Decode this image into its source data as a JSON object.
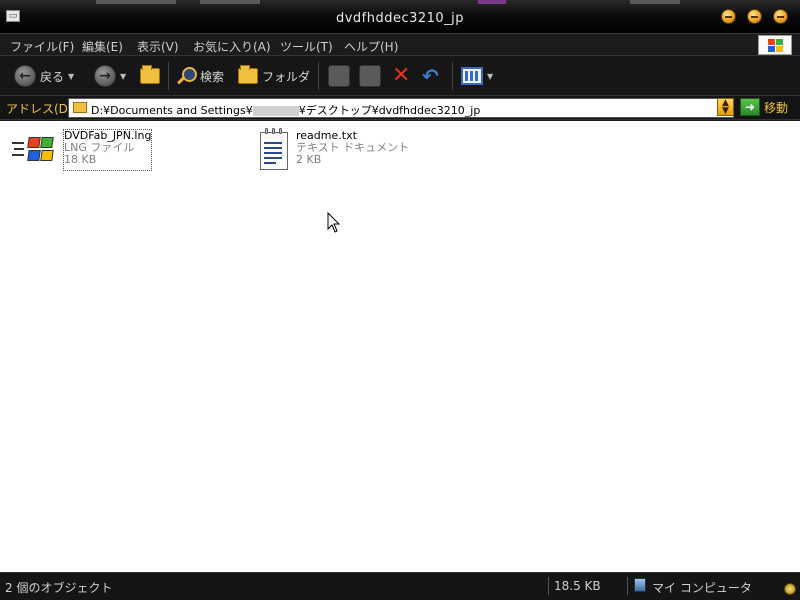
{
  "window": {
    "title": "dvdfhddec3210_jp",
    "accent": "#f0c040"
  },
  "menubar": {
    "items": [
      "ファイル(F)",
      "編集(E)",
      "表示(V)",
      "お気に入り(A)",
      "ツール(T)",
      "ヘルプ(H)"
    ]
  },
  "toolbar": {
    "back_label": "戻る",
    "search_label": "検索",
    "folders_label": "フォルダ"
  },
  "address": {
    "label": "アドレス(D)",
    "path_prefix": "D:¥Documents and Settings¥",
    "path_suffix": "¥デスクトップ¥dvdfhddec3210_jp",
    "go_label": "移動"
  },
  "files": [
    {
      "name": "DVDFab_JPN.lng",
      "type": "LNG ファイル",
      "size": "18 KB",
      "icon": "windows-flag-icon"
    },
    {
      "name": "readme.txt",
      "type": "テキスト ドキュメント",
      "size": "2 KB",
      "icon": "notepad-icon"
    }
  ],
  "status": {
    "count": "2 個のオブジェクト",
    "size": "18.5 KB",
    "location": "マイ コンピュータ"
  }
}
